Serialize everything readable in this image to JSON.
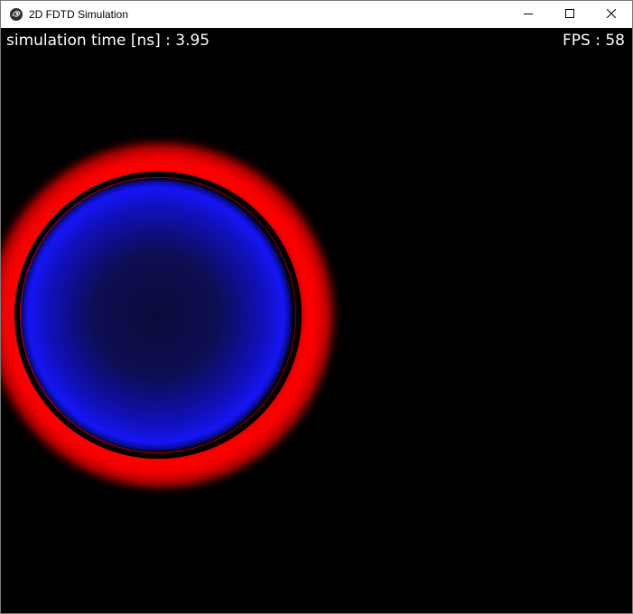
{
  "window": {
    "title": "2D FDTD Simulation",
    "icon": "app-logo-icon",
    "controls": {
      "minimize_icon": "minimize-icon",
      "maximize_icon": "maximize-icon",
      "close_icon": "close-icon"
    }
  },
  "hud": {
    "sim_time_label": "simulation time [ns] : 3.95",
    "fps_label": "FPS : 58"
  },
  "simulation": {
    "sim_time_ns": 3.95,
    "fps": 58,
    "colors": {
      "background": "#000000",
      "positive_field": "#ff0000",
      "negative_field": "#0000ff"
    }
  }
}
